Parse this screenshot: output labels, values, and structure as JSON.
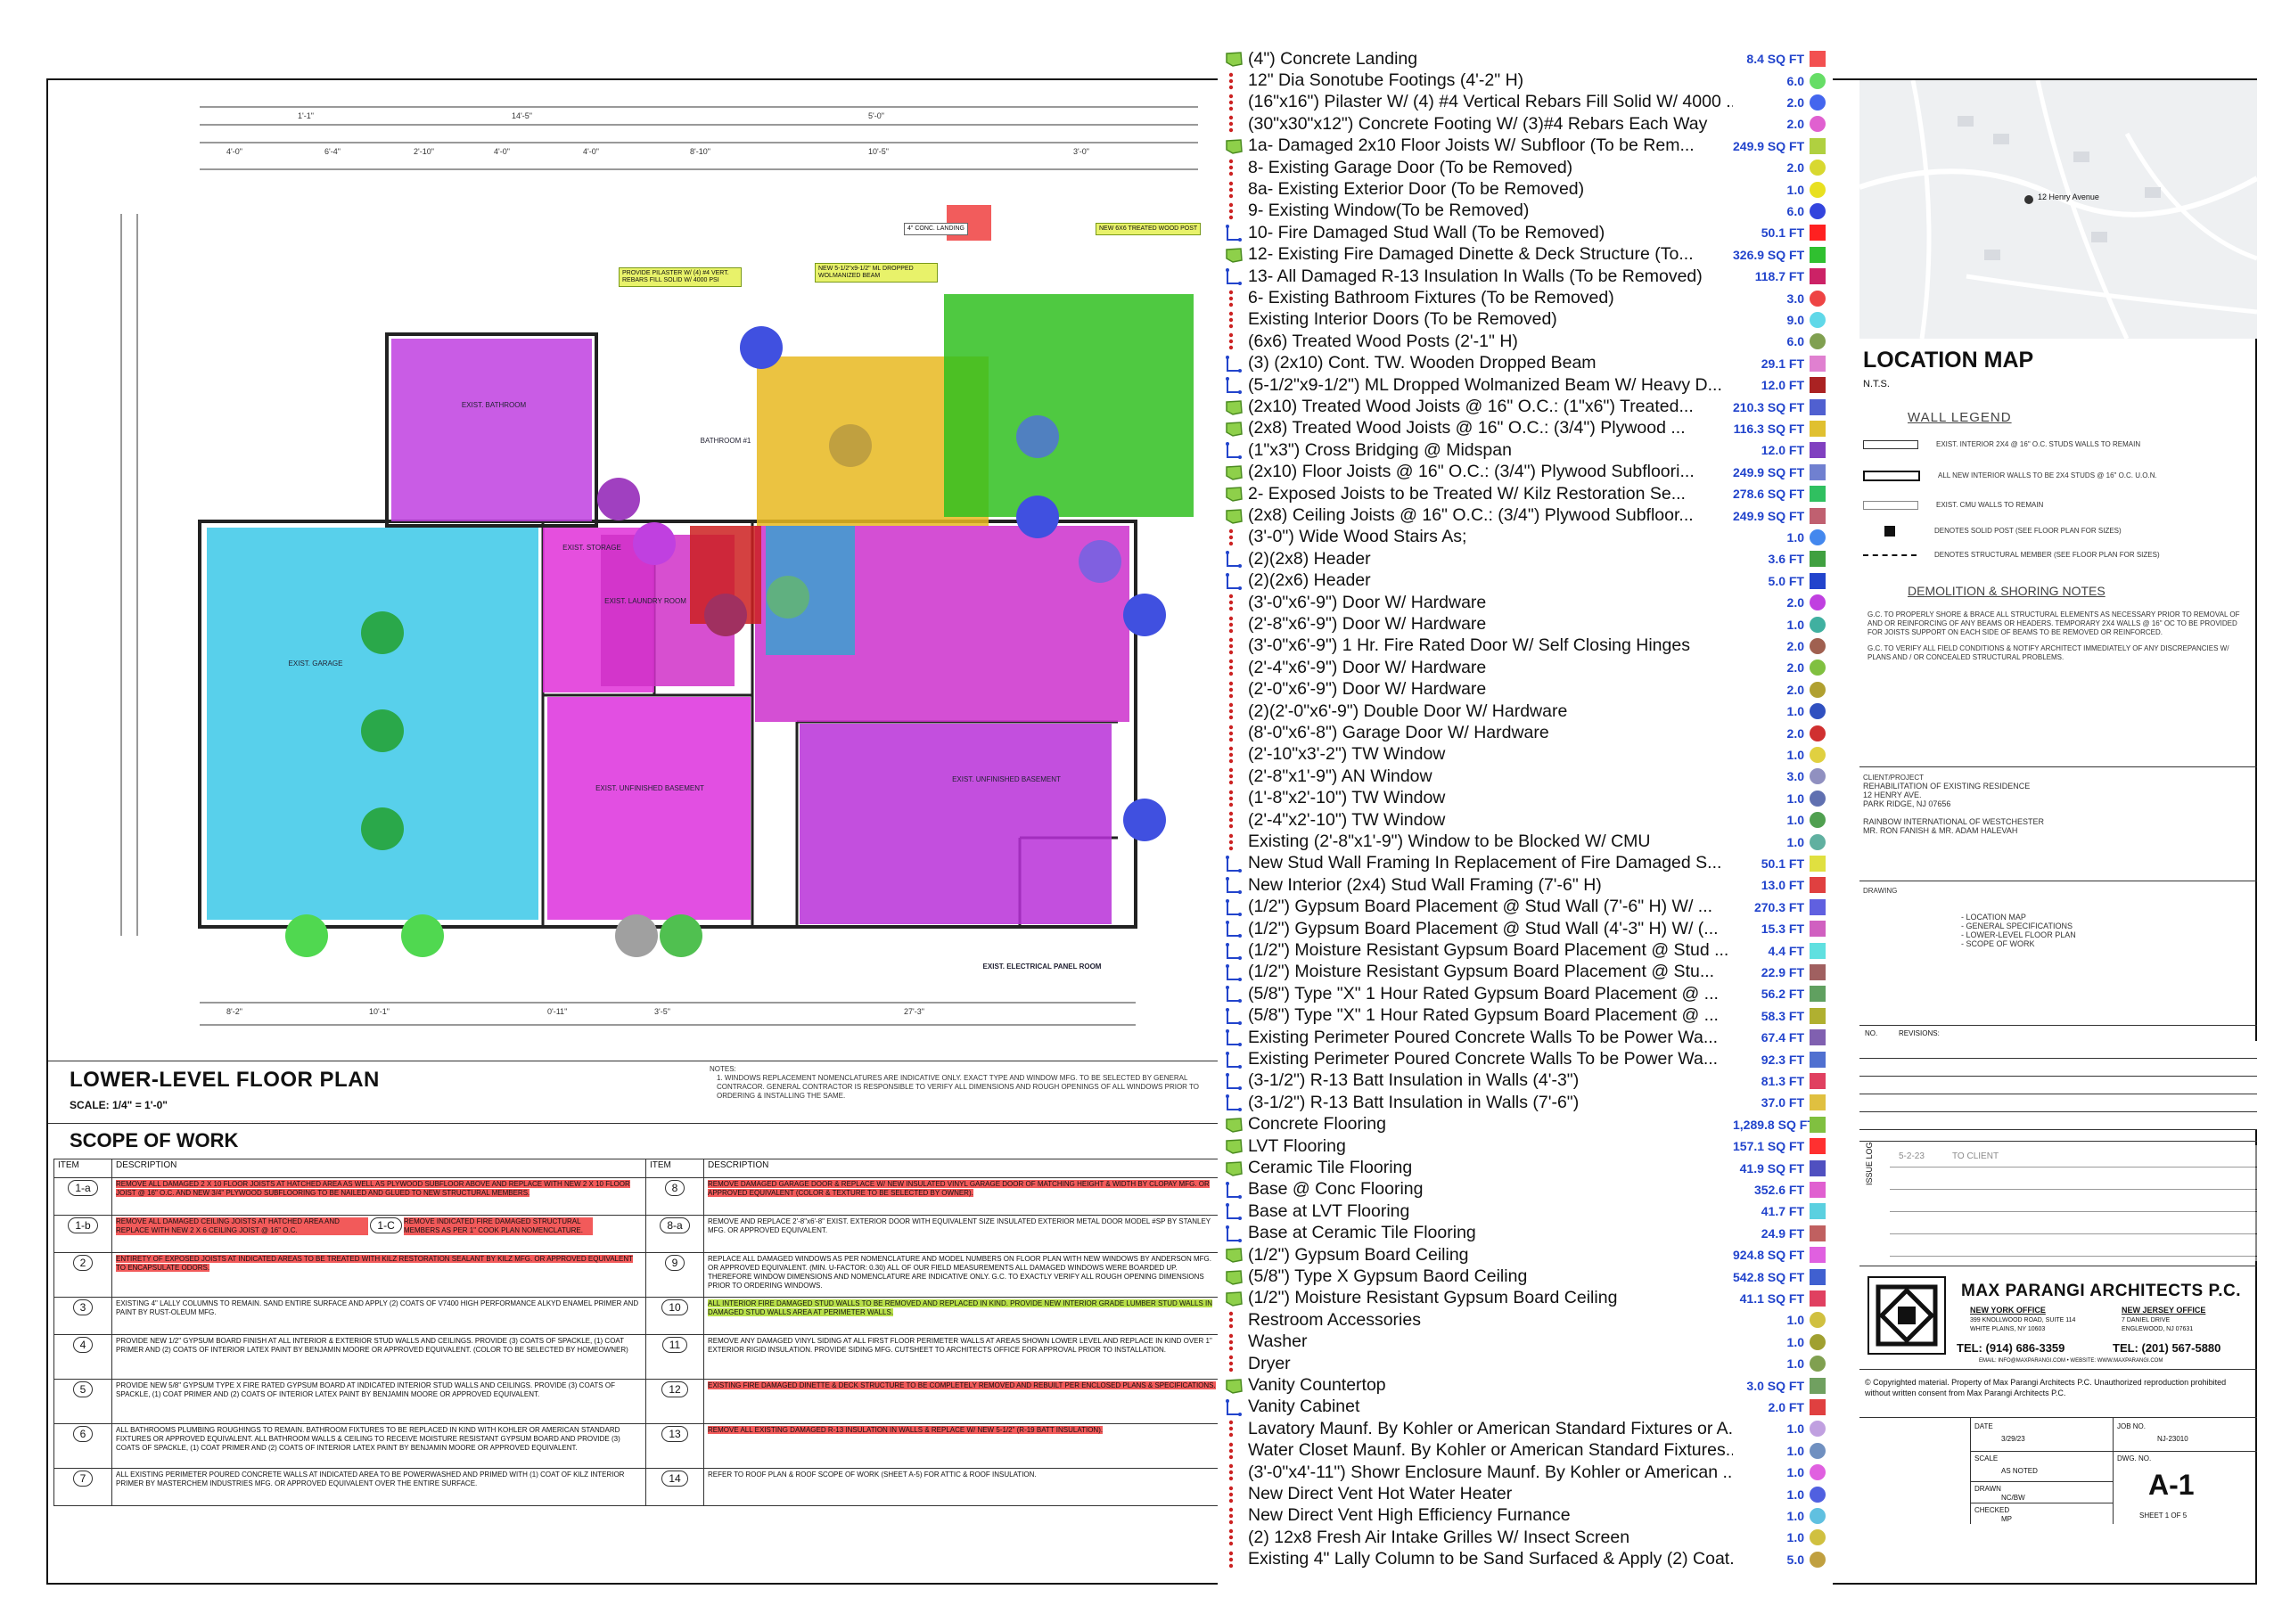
{
  "plan": {
    "title": "LOWER-LEVEL FLOOR PLAN",
    "scale": "SCALE: 1/4\" = 1'-0\"",
    "notes_heading": "NOTES:",
    "notes_text": "1. WINDOWS REPLACEMENT NOMENCLATURES ARE INDICATIVE ONLY. EXACT TYPE AND WINDOW MFG. TO BE SELECTED BY GENERAL CONTRACOR. GENERAL CONTRACTOR IS RESPONSIBLE TO VERIFY ALL DIMENSIONS AND ROUGH OPENINGS OF ALL WINDOWS PRIOR TO ORDERING & INSTALLING THE SAME.",
    "dims_top": [
      "1'-1\"",
      "14'-5\"",
      "5'-0\"",
      "4'-0\"",
      "6'-4\"",
      "2'-10\"",
      "4'-0\"",
      "4'-0\"",
      "8'-10\"",
      "10'-5\"",
      "3'-0\""
    ],
    "dims_bottom": [
      "8'-2\"",
      "10'-1\"",
      "0'-11\"",
      "3'-5\"",
      "27'-3\""
    ],
    "room_labels": [
      "EXIST. GARAGE",
      "EXIST. BATHROOM",
      "EXIST. STORAGE",
      "EXIST. LAUNDRY ROOM",
      "EXIST. UNFINISHED BASEMENT",
      "EXIST. UNFINISHED BASEMENT",
      "BATHROOM #1",
      "EXIST. ELECTRICAL PANEL ROOM"
    ],
    "tags": [
      "PROVIDE PILASTER W/ (4) #4 VERT. REBARS FILL SOLID W/ 4000 PSI",
      "NEW 5-1/2\"x9-1/2\" ML DROPPED WOLMANIZED BEAM",
      "NEW 6X6 TREATED WOOD POST",
      "4\" CONC. LANDING"
    ]
  },
  "scope": {
    "title": "SCOPE OF WORK",
    "col_item": "ITEM",
    "col_desc": "DESCRIPTION",
    "left": [
      {
        "item": "1-a",
        "text": "REMOVE ALL DAMAGED 2 X 10 FLOOR JOISTS AT HATCHED AREA AS WELL AS PLYWOOD SUBFLOOR ABOVE AND REPLACE WITH NEW 2 X 10 FLOOR JOIST @ 16\" O.C. AND NEW 3/4\" PLYWOOD SUBFLOORING TO BE NAILED AND GLUED TO NEW STRUCTURAL MEMBERS."
      },
      {
        "item": "1-b",
        "text": "REMOVE ALL DAMAGED CEILING JOISTS AT HATCHED AREA AND REPLACE WITH NEW 2 X 6 CEILING JOIST @ 16\" O.C."
      },
      {
        "item": "2",
        "text": "ENTIRETY OF EXPOSED JOISTS AT INDICATED AREAS TO BE TREATED WITH KILZ RESTORATION SEALANT BY KILZ MFG. OR APPROVED EQUIVALENT TO ENCAPSULATE ODORS."
      },
      {
        "item": "3",
        "text": "EXISTING 4\" LALLY COLUMNS TO REMAIN. SAND ENTIRE SURFACE AND APPLY (2) COATS OF V7400 HIGH PERFORMANCE ALKYD ENAMEL PRIMER AND PAINT BY RUST-OLEUM MFG."
      },
      {
        "item": "4",
        "text": "PROVIDE NEW 1/2\" GYPSUM BOARD FINISH AT ALL INTERIOR & EXTERIOR STUD WALLS AND CEILINGS. PROVIDE (3) COATS OF SPACKLE, (1) COAT PRIMER AND (2) COATS OF INTERIOR LATEX PAINT BY BENJAMIN MOORE OR APPROVED EQUIVALENT. (COLOR TO BE SELECTED BY HOMEOWNER)"
      },
      {
        "item": "5",
        "text": "PROVIDE NEW 5/8\" GYPSUM TYPE X FIRE RATED GYPSUM BOARD AT INDICATED INTERIOR STUD WALLS AND CEILINGS. PROVIDE (3) COATS OF SPACKLE, (1) COAT PRIMER AND (2) COATS OF INTERIOR LATEX PAINT BY BENJAMIN MOORE OR APPROVED EQUIVALENT."
      },
      {
        "item": "6",
        "text": "ALL BATHROOMS PLUMBING ROUGHINGS TO REMAIN. BATHROOM FIXTURES TO BE REPLACED IN KIND WITH KOHLER OR AMERICAN STANDARD FIXTURES OR APPROVED EQUIVALENT. ALL BATHROOM WALLS & CEILING TO RECEIVE MOISTURE RESISTANT GYPSUM BOARD AND PROVIDE (3) COATS OF SPACKLE, (1) COAT PRIMER AND (2) COATS OF INTERIOR LATEX PAINT BY BENJAMIN MOORE OR APPROVED EQUIVALENT."
      },
      {
        "item": "7",
        "text": "ALL EXISTING PERIMETER POURED CONCRETE WALLS AT INDICATED AREA TO BE POWERWASHED AND PRIMED WITH (1) COAT OF KILZ INTERIOR PRIMER BY MASTERCHEM INDUSTRIES MFG. OR APPROVED EQUIVALENT OVER THE ENTIRE SURFACE."
      }
    ],
    "sub_1c": {
      "item": "1-C",
      "text": "REMOVE INDICATED FIRE DAMAGED STRUCTURAL MEMBERS AS PER 1\" COOK PLAN NOMENCLATURE."
    },
    "right": [
      {
        "item": "8",
        "text": "REMOVE DAMAGED GARAGE DOOR & REPLACE W/ NEW INSULATED VINYL GARAGE DOOR OF MATCHING HEIGHT & WIDTH BY CLOPAY MFG. OR APPROVED EQUIVALENT (COLOR & TEXTURE TO BE SELECTED BY OWNER)."
      },
      {
        "item": "8-a",
        "text": "REMOVE AND REPLACE 2'-8\"x6'-8\" EXIST. EXTERIOR DOOR WITH EQUIVALENT SIZE INSULATED EXTERIOR METAL DOOR MODEL #SP BY STANLEY MFG. OR APPROVED EQUIVALENT."
      },
      {
        "item": "9",
        "text": "REPLACE ALL DAMAGED WINDOWS AS PER NOMENCLATURE AND MODEL NUMBERS ON FLOOR PLAN WITH NEW WINDOWS BY ANDERSON MFG. OR APPROVED EQUIVALENT. (MIN. U-FACTOR: 0.30) ALL OF OUR FIELD MEASUREMENTS ALL DAMAGED WINDOWS WERE BOARDED UP. THEREFORE WINDOW DIMENSIONS AND NOMENCLATURE ARE INDICATIVE ONLY. G.C. TO EXACTLY VERIFY ALL ROUGH OPENING DIMENSIONS PRIOR TO ORDERING WINDOWS."
      },
      {
        "item": "10",
        "text": "ALL INTERIOR FIRE DAMAGED STUD WALLS TO BE REMOVED AND REPLACED IN KIND. PROVIDE NEW INTERIOR GRADE LUMBER STUD WALLS IN DAMAGED STUD WALLS AREA AT PERIMETER WALLS."
      },
      {
        "item": "11",
        "text": "REMOVE ANY DAMAGED VINYL SIDING AT ALL FIRST FLOOR PERIMETER WALLS AT AREAS SHOWN LOWER LEVEL AND REPLACE IN KIND OVER 1\" EXTERIOR RIGID INSULATION. PROVIDE SIDING MFG. CUTSHEET TO ARCHITECTS OFFICE FOR APPROVAL PRIOR TO INSTALLATION."
      },
      {
        "item": "12",
        "text": "EXISTING FIRE DAMAGED DINETTE & DECK STRUCTURE TO BE COMPLETELY REMOVED AND REBUILT PER ENCLOSED PLANS & SPECIFICATIONS."
      },
      {
        "item": "13",
        "text": "REMOVE ALL EXISTING DAMAGED R-13 INSULATION IN WALLS & REPLACE W/ NEW 5-1/2\" (R-19 BATT INSULATION)."
      },
      {
        "item": "14",
        "text": "REFER TO ROOF PLAN & ROOF SCOPE OF WORK (SHEET A-5) FOR ATTIC & ROOF INSULATION."
      }
    ]
  },
  "legend": [
    {
      "icon": "area",
      "name": "(4\") Concrete Landing",
      "qty": "8.4 SQ FT",
      "color": "#f25050",
      "shape": "square"
    },
    {
      "icon": "count",
      "name": "12\" Dia Sonotube Footings (4'-2\" H)",
      "qty": "6.0",
      "color": "#66dd66",
      "shape": "circle"
    },
    {
      "icon": "count",
      "name": "(16\"x16\") Pilaster W/ (4) #4 Vertical Rebars Fill Solid W/ 4000 ...",
      "qty": "2.0",
      "color": "#4466ee",
      "shape": "circle"
    },
    {
      "icon": "count",
      "name": "(30\"x30\"x12\") Concrete Footing W/ (3)#4 Rebars Each Way",
      "qty": "2.0",
      "color": "#e060d0",
      "shape": "circle"
    },
    {
      "icon": "area",
      "name": "1a- Damaged 2x10 Floor Joists W/ Subfloor (To be Rem...",
      "qty": "249.9 SQ FT",
      "color": "#b0d040",
      "shape": "square"
    },
    {
      "icon": "count",
      "name": "8- Existing Garage Door (To be Removed)",
      "qty": "2.0",
      "color": "#d8d830",
      "shape": "circle"
    },
    {
      "icon": "count",
      "name": "8a- Existing Exterior Door (To be Removed)",
      "qty": "1.0",
      "color": "#e8e020",
      "shape": "circle"
    },
    {
      "icon": "count",
      "name": "9- Existing Window(To be Removed)",
      "qty": "6.0",
      "color": "#3344dd",
      "shape": "circle"
    },
    {
      "icon": "line",
      "name": "10- Fire Damaged Stud Wall (To be Removed)",
      "qty": "50.1 FT",
      "color": "#ff2020",
      "shape": "square"
    },
    {
      "icon": "area",
      "name": "12- Existing Fire Damaged Dinette & Deck Structure (To...",
      "qty": "326.9 SQ FT",
      "color": "#30c030",
      "shape": "square"
    },
    {
      "icon": "line",
      "name": "13- All Damaged R-13 Insulation In Walls (To be Removed)",
      "qty": "118.7 FT",
      "color": "#cc2266",
      "shape": "square"
    },
    {
      "icon": "count",
      "name": "6- Existing Bathroom Fixtures (To be Removed)",
      "qty": "3.0",
      "color": "#ee4444",
      "shape": "circle"
    },
    {
      "icon": "count",
      "name": "Existing Interior Doors (To be Removed)",
      "qty": "9.0",
      "color": "#60d8e8",
      "shape": "circle"
    },
    {
      "icon": "count",
      "name": "(6x6) Treated Wood Posts (2'-1\" H)",
      "qty": "6.0",
      "color": "#80a050",
      "shape": "circle"
    },
    {
      "icon": "line",
      "name": "(3) (2x10) Cont. TW. Wooden Dropped Beam",
      "qty": "29.1 FT",
      "color": "#e080d0",
      "shape": "square"
    },
    {
      "icon": "line",
      "name": "(5-1/2\"x9-1/2\") ML Dropped Wolmanized Beam W/ Heavy D...",
      "qty": "12.0 FT",
      "color": "#aa2222",
      "shape": "square"
    },
    {
      "icon": "area",
      "name": "(2x10) Treated Wood Joists @ 16\" O.C.: (1\"x6\") Treated...",
      "qty": "210.3 SQ FT",
      "color": "#5060d0",
      "shape": "square"
    },
    {
      "icon": "area",
      "name": "(2x8) Treated Wood Joists @ 16\" O.C.: (3/4\") Plywood ...",
      "qty": "116.3 SQ FT",
      "color": "#e0c030",
      "shape": "square"
    },
    {
      "icon": "line",
      "name": "(1\"x3\") Cross Bridging @ Midspan",
      "qty": "12.0 FT",
      "color": "#8040c0",
      "shape": "square"
    },
    {
      "icon": "area",
      "name": "(2x10) Floor Joists @ 16\" O.C.: (3/4\") Plywood Subfloori...",
      "qty": "249.9 SQ FT",
      "color": "#7080d0",
      "shape": "square"
    },
    {
      "icon": "area",
      "name": "2- Exposed Joists to be Treated W/ Kilz Restoration Se...",
      "qty": "278.6 SQ FT",
      "color": "#30c060",
      "shape": "square"
    },
    {
      "icon": "area",
      "name": "(2x8) Ceiling Joists @ 16\" O.C.: (3/4\") Plywood Subfloor...",
      "qty": "249.9 SQ FT",
      "color": "#c06070",
      "shape": "square"
    },
    {
      "icon": "count",
      "name": "(3'-0\") Wide Wood Stairs As;",
      "qty": "1.0",
      "color": "#4488ee",
      "shape": "circle"
    },
    {
      "icon": "line",
      "name": "(2)(2x8) Header",
      "qty": "3.6 FT",
      "color": "#40a040",
      "shape": "square"
    },
    {
      "icon": "line",
      "name": "(2)(2x6) Header",
      "qty": "5.0 FT",
      "color": "#2244cc",
      "shape": "square"
    },
    {
      "icon": "count",
      "name": "(3'-0\"x6'-9\") Door W/ Hardware",
      "qty": "2.0",
      "color": "#c040e0",
      "shape": "circle"
    },
    {
      "icon": "count",
      "name": "(2'-8\"x6'-9\") Door W/ Hardware",
      "qty": "1.0",
      "color": "#40b0a0",
      "shape": "circle"
    },
    {
      "icon": "count",
      "name": "(3'-0\"x6'-9\") 1 Hr. Fire Rated Door W/ Self Closing Hinges",
      "qty": "2.0",
      "color": "#a06050",
      "shape": "circle"
    },
    {
      "icon": "count",
      "name": "(2'-4\"x6'-9\") Door W/ Hardware",
      "qty": "2.0",
      "color": "#80c040",
      "shape": "circle"
    },
    {
      "icon": "count",
      "name": "(2'-0\"x6'-9\") Door W/ Hardware",
      "qty": "2.0",
      "color": "#b0a030",
      "shape": "circle"
    },
    {
      "icon": "count",
      "name": "(2)(2'-0\"x6'-9\") Double Door W/ Hardware",
      "qty": "1.0",
      "color": "#3050c0",
      "shape": "circle"
    },
    {
      "icon": "count",
      "name": "(8'-0\"x6'-8\") Garage Door W/ Hardware",
      "qty": "2.0",
      "color": "#d03030",
      "shape": "circle"
    },
    {
      "icon": "count",
      "name": "(2'-10\"x3'-2\") TW Window",
      "qty": "1.0",
      "color": "#e0d040",
      "shape": "circle"
    },
    {
      "icon": "count",
      "name": "(2'-8\"x1'-9\") AN Window",
      "qty": "3.0",
      "color": "#9090c0",
      "shape": "circle"
    },
    {
      "icon": "count",
      "name": "(1'-8\"x2'-10\") TW Window",
      "qty": "1.0",
      "color": "#6070b0",
      "shape": "circle"
    },
    {
      "icon": "count",
      "name": "(2'-4\"x2'-10\") TW Window",
      "qty": "1.0",
      "color": "#50a050",
      "shape": "circle"
    },
    {
      "icon": "count",
      "name": "Existing (2'-8\"x1'-9\") Window to be Blocked W/ CMU",
      "qty": "1.0",
      "color": "#60b0a0",
      "shape": "circle"
    },
    {
      "icon": "line",
      "name": "New Stud Wall Framing In Replacement of Fire Damaged S...",
      "qty": "50.1 FT",
      "color": "#e0e040",
      "shape": "square"
    },
    {
      "icon": "line",
      "name": "New Interior (2x4) Stud Wall Framing (7'-6\" H)",
      "qty": "13.0 FT",
      "color": "#e04040",
      "shape": "square"
    },
    {
      "icon": "line",
      "name": "(1/2\") Gypsum Board Placement @ Stud Wall (7'-6\" H) W/ ...",
      "qty": "270.3 FT",
      "color": "#6060e0",
      "shape": "square"
    },
    {
      "icon": "line",
      "name": "(1/2\") Gypsum Board Placement @ Stud Wall (4'-3\" H) W/ (...",
      "qty": "15.3 FT",
      "color": "#d060c0",
      "shape": "square"
    },
    {
      "icon": "line",
      "name": "(1/2\") Moisture Resistant Gypsum Board Placement @ Stud ...",
      "qty": "4.4 FT",
      "color": "#60e0e0",
      "shape": "square"
    },
    {
      "icon": "line",
      "name": "(1/2\") Moisture Resistant Gypsum Board Placement @ Stu...",
      "qty": "22.9 FT",
      "color": "#a06060",
      "shape": "square"
    },
    {
      "icon": "line",
      "name": "(5/8\") Type \"X\" 1 Hour Rated Gypsum Board Placement @ ...",
      "qty": "56.2 FT",
      "color": "#60a060",
      "shape": "square"
    },
    {
      "icon": "line",
      "name": "(5/8\") Type \"X\" 1 Hour Rated Gypsum Board Placement @ ...",
      "qty": "58.3 FT",
      "color": "#b0b030",
      "shape": "square"
    },
    {
      "icon": "line",
      "name": "Existing Perimeter Poured Concrete Walls To be Power Wa...",
      "qty": "67.4 FT",
      "color": "#8060b0",
      "shape": "square"
    },
    {
      "icon": "line",
      "name": "Existing Perimeter Poured Concrete Walls To be Power Wa...",
      "qty": "92.3 FT",
      "color": "#5070d0",
      "shape": "square"
    },
    {
      "icon": "line",
      "name": "(3-1/2\") R-13 Batt Insulation in Walls (4'-3\")",
      "qty": "81.3 FT",
      "color": "#e04060",
      "shape": "square"
    },
    {
      "icon": "line",
      "name": "(3-1/2\") R-13 Batt Insulation in Walls (7'-6\")",
      "qty": "37.0 FT",
      "color": "#e0c040",
      "shape": "square"
    },
    {
      "icon": "area",
      "name": "Concrete Flooring",
      "qty": "1,289.8 SQ FT",
      "color": "#80c040",
      "shape": "square"
    },
    {
      "icon": "area",
      "name": "LVT Flooring",
      "qty": "157.1 SQ FT",
      "color": "#ff3030",
      "shape": "square"
    },
    {
      "icon": "area",
      "name": "Ceramic Tile Flooring",
      "qty": "41.9 SQ FT",
      "color": "#5050c0",
      "shape": "square"
    },
    {
      "icon": "line",
      "name": "Base @ Conc Flooring",
      "qty": "352.6 FT",
      "color": "#e060d0",
      "shape": "square"
    },
    {
      "icon": "line",
      "name": "Base at LVT Flooring",
      "qty": "41.7 FT",
      "color": "#5bd0e0",
      "shape": "square"
    },
    {
      "icon": "line",
      "name": "Base at Ceramic Tile Flooring",
      "qty": "24.9 FT",
      "color": "#c06060",
      "shape": "square"
    },
    {
      "icon": "area",
      "name": "(1/2\") Gypsum Board Ceiling",
      "qty": "924.8 SQ FT",
      "color": "#e060e0",
      "shape": "square"
    },
    {
      "icon": "area",
      "name": "(5/8\") Type X Gypsum Baord Ceiling",
      "qty": "542.8 SQ FT",
      "color": "#4060d0",
      "shape": "square"
    },
    {
      "icon": "area",
      "name": "(1/2\") Moisture Resistant Gypsum Board Ceiling",
      "qty": "41.1 SQ FT",
      "color": "#e04060",
      "shape": "square"
    },
    {
      "icon": "count",
      "name": "Restroom Accessories",
      "qty": "1.0",
      "color": "#d0c040",
      "shape": "circle"
    },
    {
      "icon": "count",
      "name": "Washer",
      "qty": "1.0",
      "color": "#a0a030",
      "shape": "circle"
    },
    {
      "icon": "count",
      "name": "Dryer",
      "qty": "1.0",
      "color": "#80a050",
      "shape": "circle"
    },
    {
      "icon": "area",
      "name": "Vanity Countertop",
      "qty": "3.0 SQ FT",
      "color": "#70a060",
      "shape": "square"
    },
    {
      "icon": "line",
      "name": "Vanity Cabinet",
      "qty": "2.0 FT",
      "color": "#e04040",
      "shape": "square"
    },
    {
      "icon": "count",
      "name": "Lavatory Maunf. By Kohler or American Standard Fixtures or A...",
      "qty": "1.0",
      "color": "#c0a0e0",
      "shape": "circle"
    },
    {
      "icon": "count",
      "name": "Water Closet Maunf. By Kohler or American Standard Fixtures...",
      "qty": "1.0",
      "color": "#7090c0",
      "shape": "circle"
    },
    {
      "icon": "count",
      "name": "(3'-0\"x4'-11\") Showr Enclosure Maunf. By Kohler or American ...",
      "qty": "1.0",
      "color": "#e060e0",
      "shape": "circle"
    },
    {
      "icon": "count",
      "name": "New Direct Vent Hot Water Heater",
      "qty": "1.0",
      "color": "#5060e0",
      "shape": "circle"
    },
    {
      "icon": "count",
      "name": "New Direct Vent High Efficiency Furnance",
      "qty": "1.0",
      "color": "#60c0e0",
      "shape": "circle"
    },
    {
      "icon": "count",
      "name": "(2) 12x8 Fresh Air Intake Grilles W/ Insect Screen",
      "qty": "1.0",
      "color": "#d0c040",
      "shape": "circle"
    },
    {
      "icon": "count",
      "name": "Existing 4\" Lally Column to be Sand Surfaced & Apply (2) Coat...",
      "qty": "5.0",
      "color": "#c0a040",
      "shape": "circle"
    }
  ],
  "location": {
    "title": "LOCATION MAP",
    "nts": "N.T.S.",
    "pin_label": "12 Henry Avenue"
  },
  "wall_legend": {
    "title": "WALL LEGEND",
    "rows": [
      "EXIST. INTERIOR 2X4 @ 16\" O.C. STUDS WALLS TO REMAIN",
      "ALL NEW INTERIOR WALLS TO BE 2X4 STUDS @ 16\" O.C. U.O.N.",
      "EXIST. CMU WALLS TO REMAIN",
      "DENOTES SOLID POST (SEE FLOOR PLAN FOR SIZES)",
      "DENOTES STRUCTURAL MEMBER (SEE FLOOR PLAN FOR SIZES)"
    ]
  },
  "demolition": {
    "title": "DEMOLITION & SHORING NOTES",
    "text1": "G.C. TO PROPERLY SHORE & BRACE ALL STRUCTURAL ELEMENTS AS NECESSARY PRIOR TO REMOVAL OF AND OR REINFORCING OF ANY BEAMS OR HEADERS. TEMPORARY 2X4 WALLS @ 16\" OC TO BE PROVIDED FOR JOISTS SUPPORT ON EACH SIDE OF BEAMS TO BE REMOVED OR REINFORCED.",
    "text2": "G.C. TO VERIFY ALL FIELD CONDITIONS & NOTIFY ARCHITECT IMMEDIATELY OF ANY DISCREPANCIES W/ PLANS AND / OR CONCEALED STRUCTURAL PROBLEMS."
  },
  "project": {
    "label": "CLIENT/PROJECT",
    "lines": [
      "REHABILITATION OF EXISTING RESIDENCE",
      "12 HENRY AVE.",
      "PARK RIDGE, NJ 07656",
      "RAINBOW INTERNATIONAL OF WESTCHESTER",
      "MR. RON FANISH & MR. ADAM HALEVAH"
    ]
  },
  "drawing": {
    "label": "DRAWING",
    "items": [
      "- LOCATION MAP",
      "- GENERAL SPECIFICATIONS",
      "- LOWER-LEVEL FLOOR PLAN",
      "- SCOPE OF WORK"
    ]
  },
  "revisions": {
    "no": "NO.",
    "label": "REVISIONS:"
  },
  "issue_log": {
    "label": "ISSUE LOG",
    "date": "5-2-23",
    "text": "TO CLIENT"
  },
  "firm": {
    "name": "MAX PARANGI ARCHITECTS P.C.",
    "ny_title": "NEW YORK OFFICE",
    "ny_addr1": "399 KNOLLWOOD ROAD, SUITE 114",
    "ny_addr2": "WHITE PLAINS, NY 10603",
    "nj_title": "NEW JERSEY OFFICE",
    "nj_addr1": "7 DANIEL DRIVE",
    "nj_addr2": "ENGLEWOOD, NJ 07631",
    "ny_tel": "TEL: (914) 686-3359",
    "nj_tel": "TEL: (201) 567-5880",
    "web": "EMAIL: INFO@MAXPARANGI.COM  •  WEBSITE: WWW.MAXPARANGI.COM",
    "copyright": "© Copyrighted material. Property of Max Parangi Architects P.C. Unauthorized reproduction prohibited without written consent from Max Parangi Architects P.C."
  },
  "titleblock": {
    "date_label": "DATE",
    "date": "3/29/23",
    "job_label": "JOB NO.",
    "job": "NJ-23010",
    "scale_label": "SCALE",
    "scale": "AS NOTED",
    "dwg_label": "DWG. NO.",
    "dwg": "A-1",
    "drawn_label": "DRAWN",
    "drawn": "NC/BW",
    "checked_label": "CHECKED",
    "checked": "MP",
    "sheet": "SHEET  1  OF  5"
  }
}
